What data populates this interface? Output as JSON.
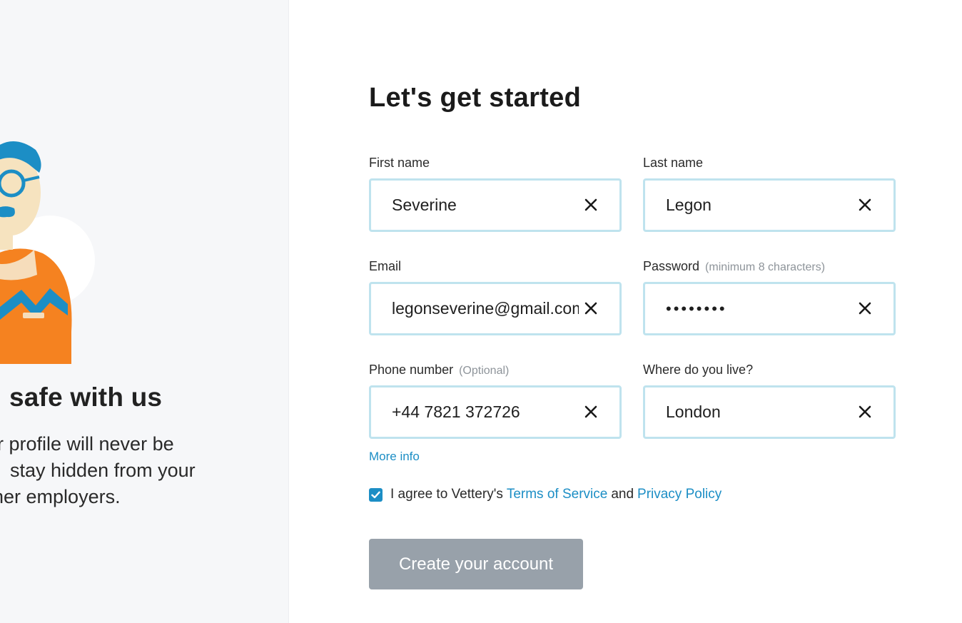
{
  "left": {
    "heading": "safe with us",
    "lines": [
      "r profile will never be",
      "stay hidden from your",
      "ner employers."
    ]
  },
  "form": {
    "title": "Let's get started",
    "fields": {
      "first_name": {
        "label": "First name",
        "value": "Severine"
      },
      "last_name": {
        "label": "Last name",
        "value": "Legon"
      },
      "email": {
        "label": "Email",
        "value": "legonseverine@gmail.com"
      },
      "password": {
        "label": "Password",
        "hint": "(minimum 8 characters)",
        "value": "••••••••"
      },
      "phone": {
        "label": "Phone number",
        "hint": "(Optional)",
        "value": "+44 7821 372726"
      },
      "location": {
        "label": "Where do you live?",
        "value": "London"
      }
    },
    "more_info": "More info",
    "agree": {
      "checked": true,
      "prefix": "I agree to Vettery's",
      "terms": "Terms of Service",
      "and": "and",
      "privacy": "Privacy Policy"
    },
    "submit": "Create your account"
  },
  "colors": {
    "accent": "#1c8ec5",
    "input_border": "#bfe3ee",
    "button_disabled": "#98a1aa",
    "left_panel_bg": "#f6f7f9"
  },
  "icons": {
    "clear": "close-icon",
    "checkbox": "check-icon"
  }
}
